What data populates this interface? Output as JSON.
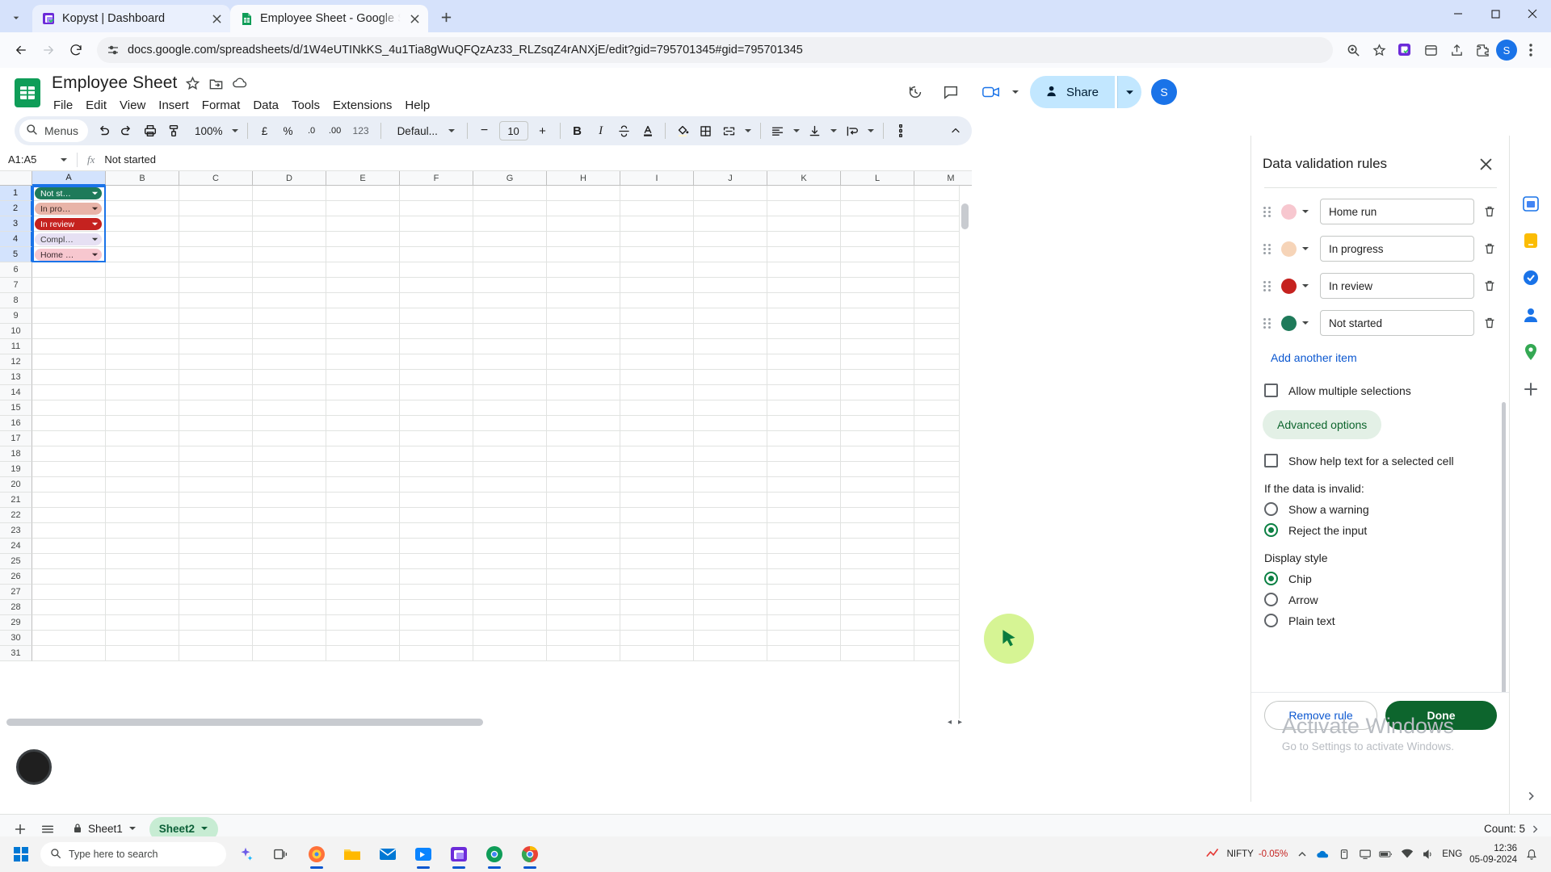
{
  "browser": {
    "tabs": [
      {
        "title": "Kopyst | Dashboard",
        "favicon": "kopyst-icon",
        "active": false
      },
      {
        "title": "Employee Sheet - Google Sheet",
        "favicon": "google-sheets-icon",
        "active": true
      }
    ],
    "new_tab_label": "+",
    "url": "docs.google.com/spreadsheets/d/1W4eUTINkKS_4u1Tia8gWuQFQzAz33_RLZsqZ4rANXjE/edit?gid=795701345#gid=795701345",
    "profile_initial": "S",
    "window_controls": [
      "minimize",
      "maximize",
      "close"
    ]
  },
  "sheets": {
    "doc_title": "Employee Sheet",
    "menus": [
      "File",
      "Edit",
      "View",
      "Insert",
      "Format",
      "Data",
      "Tools",
      "Extensions",
      "Help"
    ],
    "share_label": "Share",
    "user_initial": "S",
    "toolbar": {
      "menus_label": "Menus",
      "zoom": "100%",
      "currency": "£",
      "percent": "%",
      "decimal_less": ".0",
      "decimal_more": ".00",
      "number_format": "123",
      "font": "Defaul...",
      "font_size": "10",
      "bold": "B",
      "italic": "I",
      "minus": "−",
      "plus": "+"
    },
    "name_box": "A1:A5",
    "formula_value": "Not started",
    "columns": [
      "A",
      "B",
      "C",
      "D",
      "E",
      "F",
      "G",
      "H",
      "I",
      "J",
      "K",
      "L",
      "M"
    ],
    "rows": [
      1,
      2,
      3,
      4,
      5,
      6,
      7,
      8,
      9,
      10,
      11,
      12,
      13,
      14,
      15,
      16,
      17,
      18,
      19,
      20,
      21,
      22,
      23,
      24,
      25,
      26,
      27,
      28,
      29,
      30,
      31
    ],
    "cells_a": [
      {
        "row": 1,
        "label": "Not st…",
        "bg": "#1e7a5a",
        "fg": "#ffffff"
      },
      {
        "row": 2,
        "label": "In pro…",
        "bg": "#e8b4a8",
        "fg": "#3c2a26"
      },
      {
        "row": 3,
        "label": "In review",
        "bg": "#c5221f",
        "fg": "#ffffff"
      },
      {
        "row": 4,
        "label": "Compl…",
        "bg": "#e6e0f3",
        "fg": "#3c3c3c"
      },
      {
        "row": 5,
        "label": "Home …",
        "bg": "#f7c7cf",
        "fg": "#3c2a2e"
      }
    ],
    "sheet_tabs": [
      {
        "label": "Sheet1",
        "locked": true,
        "active": false
      },
      {
        "label": "Sheet2",
        "locked": false,
        "active": true
      }
    ],
    "status_count": "Count: 5"
  },
  "panel": {
    "title": "Data validation rules",
    "rules": [
      {
        "color": "#f7c7cf",
        "value": "Home run"
      },
      {
        "color": "#f6d4b8",
        "value": "In progress"
      },
      {
        "color": "#c5221f",
        "value": "In review"
      },
      {
        "color": "#1e7a5a",
        "value": "Not started"
      }
    ],
    "add_item_label": "Add another item",
    "allow_multiple_label": "Allow multiple selections",
    "advanced_options_label": "Advanced options",
    "show_help_label": "Show help text for a selected cell",
    "invalid_section_label": "If the data is invalid:",
    "invalid_options": [
      {
        "label": "Show a warning",
        "selected": false
      },
      {
        "label": "Reject the input",
        "selected": true
      }
    ],
    "display_style_label": "Display style",
    "display_options": [
      {
        "label": "Chip",
        "selected": true
      },
      {
        "label": "Arrow",
        "selected": false
      },
      {
        "label": "Plain text",
        "selected": false
      }
    ],
    "remove_rule_label": "Remove rule",
    "done_label": "Done"
  },
  "watermark": {
    "line1": "Activate Windows",
    "line2": "Go to Settings to activate Windows."
  },
  "taskbar": {
    "search_placeholder": "Type here to search",
    "nifty_label": "NIFTY",
    "nifty_change": "-0.05%",
    "language": "ENG",
    "time": "12:36",
    "date": "05-09-2024"
  }
}
